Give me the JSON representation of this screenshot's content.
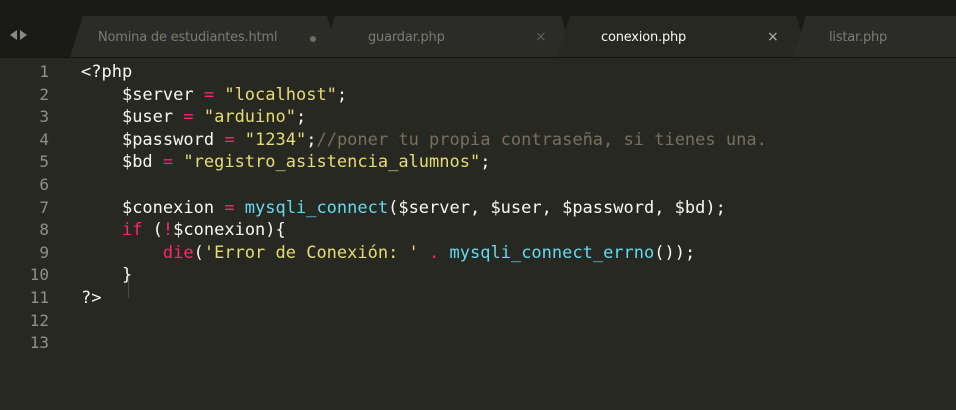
{
  "tabs": [
    {
      "label": "Nomina de estudiantes.html",
      "state": "modified",
      "active": false
    },
    {
      "label": "guardar.php",
      "state": "close",
      "active": false,
      "action": "×"
    },
    {
      "label": "conexion.php",
      "state": "close",
      "active": true,
      "action": "×"
    },
    {
      "label": "listar.php",
      "state": "none",
      "active": false
    }
  ],
  "gutter": {
    "line_numbers": [
      "1",
      "2",
      "3",
      "4",
      "5",
      "6",
      "7",
      "8",
      "9",
      "10",
      "11",
      "12",
      "13"
    ]
  },
  "code": {
    "l1": {
      "open": "<?php"
    },
    "l2": {
      "indent": "    ",
      "var": "$server",
      "op": " = ",
      "str": "\"localhost\"",
      "end": ";"
    },
    "l3": {
      "indent": "    ",
      "var": "$user",
      "op": " = ",
      "str": "\"arduino\"",
      "end": ";"
    },
    "l4": {
      "indent": "    ",
      "var": "$password",
      "op": " = ",
      "str": "\"1234\"",
      "end": ";",
      "comment": "//poner tu propia contraseña, si tienes una."
    },
    "l5": {
      "indent": "    ",
      "var": "$bd",
      "op": " = ",
      "str": "\"registro_asistencia_alumnos\"",
      "end": ";"
    },
    "l7": {
      "indent": "    ",
      "var": "$conexion",
      "op": " = ",
      "fn": "mysqli_connect",
      "args": "($server, $user, $password, $bd);"
    },
    "l8": {
      "indent": "    ",
      "kw": "if",
      "p1": " (",
      "not": "!",
      "rest": "$conexion){"
    },
    "l9": {
      "indent": "        ",
      "kw": "die",
      "p1": "(",
      "str": "'Error de Conexión: '",
      "sp": " ",
      "op": ".",
      "sp2": " ",
      "fn": "mysqli_connect_errno",
      "end": "());"
    },
    "l10": {
      "indent": "    ",
      "text": "}"
    },
    "l11": {
      "close": "?>"
    }
  },
  "colors": {
    "background": "#272822",
    "keyword": "#f92672",
    "string": "#e6db74",
    "function": "#66d9ef",
    "comment": "#75715e",
    "text": "#f8f8f2"
  }
}
